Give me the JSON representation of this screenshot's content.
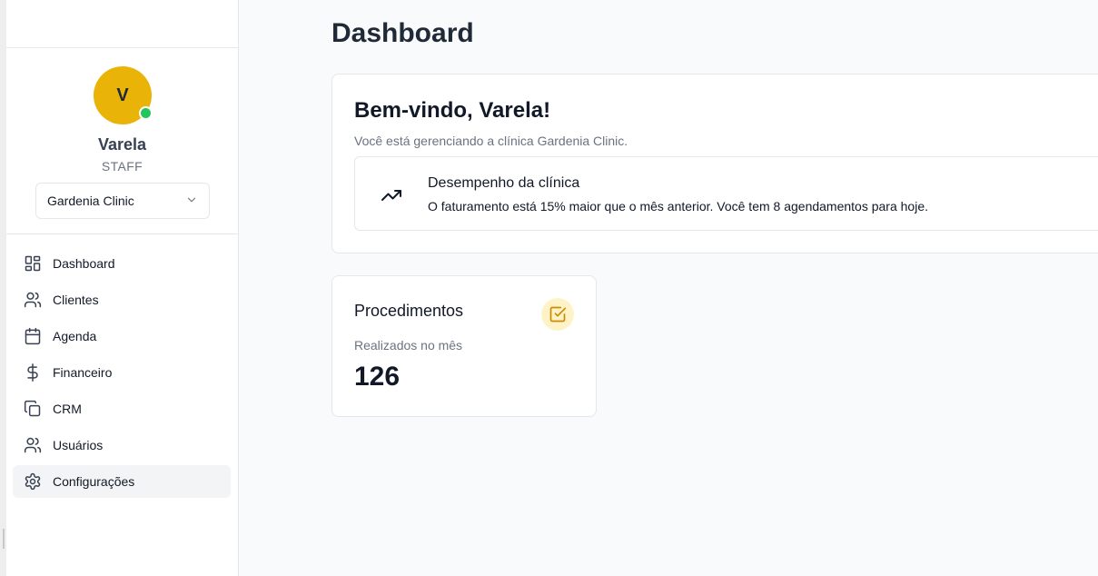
{
  "user": {
    "initial": "V",
    "name": "Varela",
    "role": "STAFF",
    "status": "online"
  },
  "clinic_selector": {
    "selected": "Gardenia Clinic"
  },
  "nav": {
    "items": [
      {
        "label": "Dashboard",
        "icon": "layout-dashboard-icon"
      },
      {
        "label": "Clientes",
        "icon": "users-icon"
      },
      {
        "label": "Agenda",
        "icon": "calendar-icon"
      },
      {
        "label": "Financeiro",
        "icon": "dollar-icon"
      },
      {
        "label": "CRM",
        "icon": "copy-icon"
      },
      {
        "label": "Usuários",
        "icon": "users-icon"
      },
      {
        "label": "Configurações",
        "icon": "gear-icon"
      }
    ],
    "active": "Configurações"
  },
  "page": {
    "title": "Dashboard"
  },
  "welcome": {
    "title": "Bem-vindo, Varela!",
    "subtitle": "Você está gerenciando a clínica Gardenia Clinic.",
    "performance": {
      "title": "Desempenho da clínica",
      "description": "O faturamento está 15% maior que o mês anterior. Você tem 8 agendamentos para hoje.",
      "icon": "trending-up-icon"
    }
  },
  "stats": {
    "procedures": {
      "title": "Procedimentos",
      "subtitle": "Realizados no mês",
      "value": "126",
      "icon": "check-square-icon"
    }
  },
  "colors": {
    "avatar": "#eab308",
    "status_online": "#22c55e",
    "stat_icon_bg": "#fef3c7",
    "stat_icon_fg": "#ca8a04"
  }
}
